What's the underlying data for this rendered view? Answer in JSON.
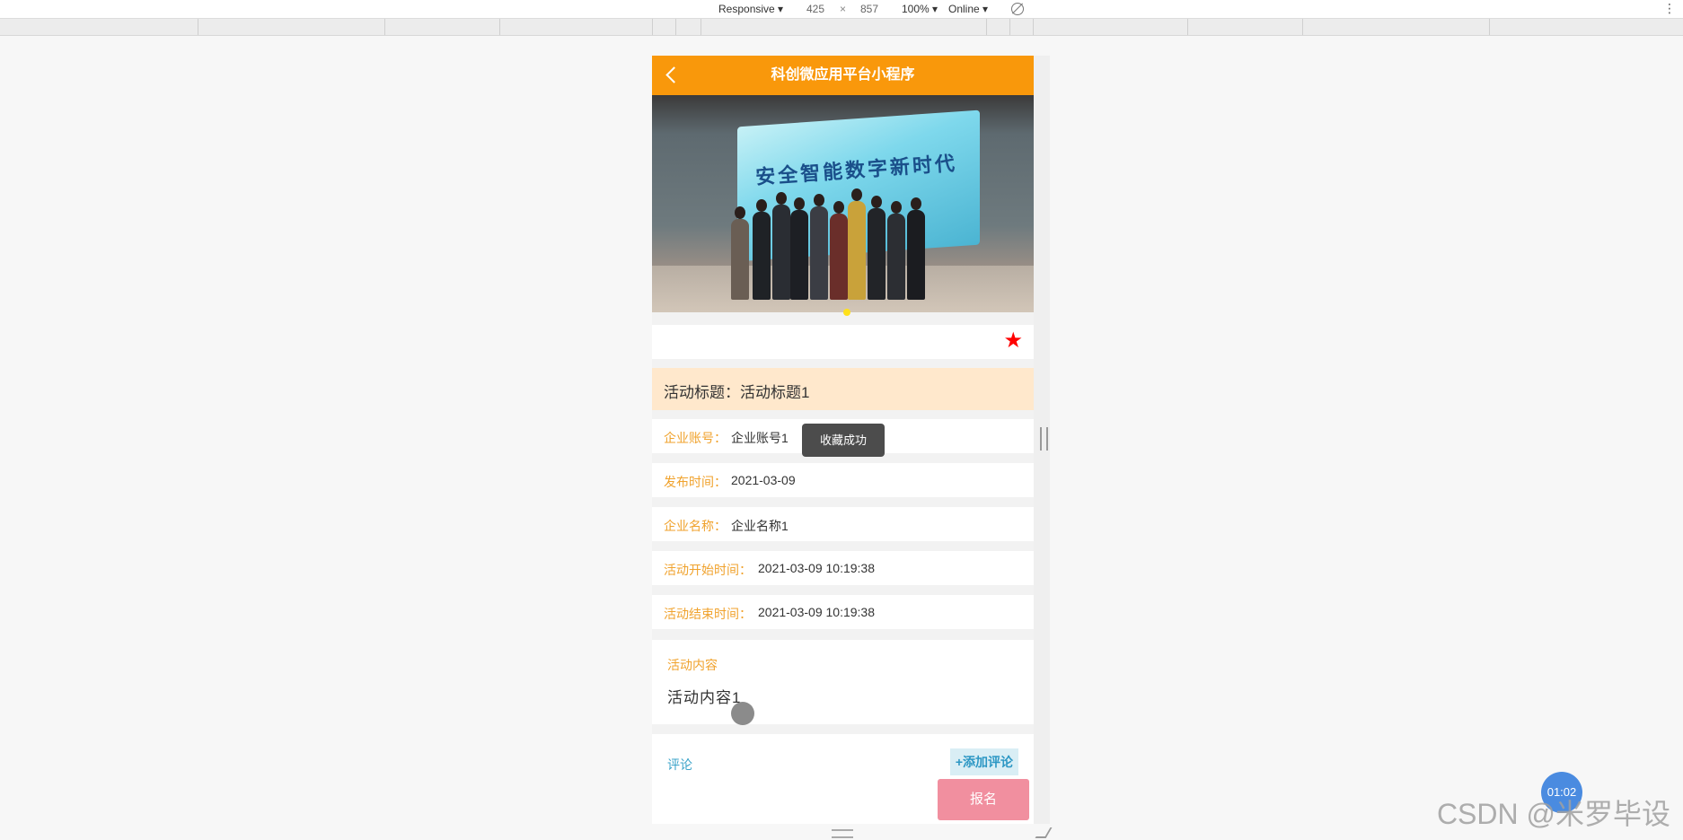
{
  "devtools": {
    "device": "Responsive ▾",
    "width": "425",
    "times": "×",
    "height": "857",
    "zoom": "100% ▾",
    "network": "Online ▾",
    "more": "⋮"
  },
  "app": {
    "nav_title": "科创微应用平台小程序",
    "banner_text": "安全智能数字新时代",
    "title_label": "活动标题：",
    "title_value": "活动标题1",
    "fields": [
      {
        "label": "企业账号：",
        "value": "企业账号1"
      },
      {
        "label": "发布时间：",
        "value": "2021-03-09"
      },
      {
        "label": "企业名称：",
        "value": "企业名称1"
      },
      {
        "label": "活动开始时间：",
        "value": "2021-03-09 10:19:38"
      },
      {
        "label": "活动结束时间：",
        "value": "2021-03-09 10:19:38"
      }
    ],
    "toast": "收藏成功",
    "content_label": "活动内容",
    "content_value": "活动内容1",
    "comment_label": "评论",
    "add_comment": "+添加评论",
    "signup": "报名",
    "star": "★"
  },
  "overlay": {
    "timer": "01:02",
    "watermark": "CSDN @米罗毕设"
  },
  "colors": {
    "nav": "#f9980b",
    "label": "#f0a22c",
    "star": "#ff0000",
    "title_bg": "#ffe8cc",
    "signup": "#f18f9f",
    "comment": "#3aa3c9"
  }
}
